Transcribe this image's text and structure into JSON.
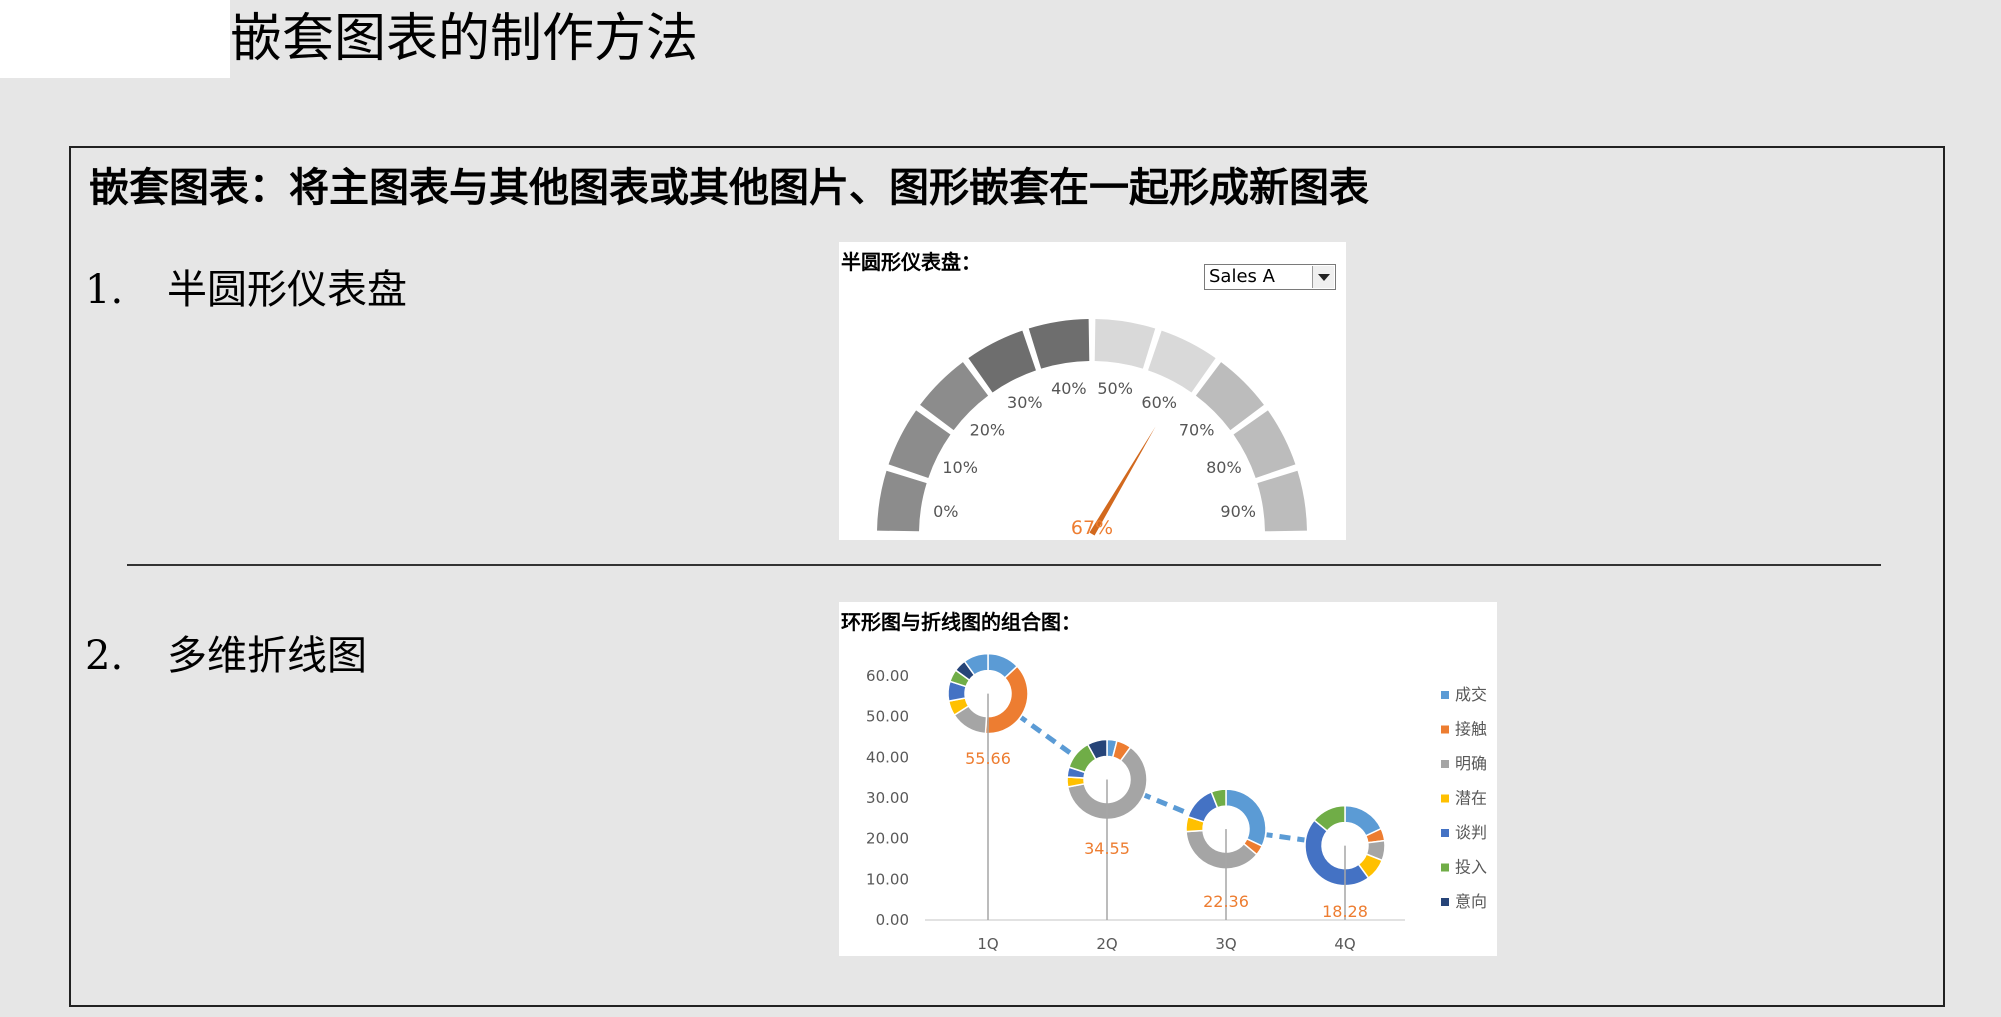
{
  "page": {
    "title": "嵌套图表的制作方法"
  },
  "frame": {
    "heading": "嵌套图表：将主图表与其他图表或其他图片、图形嵌套在一起形成新图表",
    "items": [
      {
        "number": "1.",
        "label": "半圆形仪表盘"
      },
      {
        "number": "2.",
        "label": "多维折线图"
      }
    ]
  },
  "gauge": {
    "heading": "半圆形仪表盘：",
    "selector_value": "Sales A",
    "value_label": "67%"
  },
  "combo": {
    "heading": "环形图与折线图的组合图："
  },
  "colors": {
    "page_bg": "#e6e6e6",
    "gauge_dark": "#6e6e6e",
    "gauge_mid": "#8c8c8c",
    "gauge_light": "#bcbcbc",
    "gauge_lighter": "#d9d9d9",
    "needle": "#d2691e",
    "value_text": "#ed7d31",
    "line": "#5b9bd5"
  },
  "chart_data": [
    {
      "type": "gauge",
      "title": "半圆形仪表盘：",
      "selector": "Sales A",
      "ticks": [
        "0%",
        "10%",
        "20%",
        "30%",
        "40%",
        "50%",
        "60%",
        "70%",
        "80%",
        "90%"
      ],
      "value": 0.67,
      "value_label": "67%"
    },
    {
      "type": "line",
      "title": "环形图与折线图的组合图：",
      "categories": [
        "1Q",
        "2Q",
        "3Q",
        "4Q"
      ],
      "values": [
        55.66,
        34.55,
        22.36,
        18.28
      ],
      "value_labels": [
        "55.66",
        "34.55",
        "22.36",
        "18.28"
      ],
      "y_ticks": [
        "0.00",
        "10.00",
        "20.00",
        "30.00",
        "40.00",
        "50.00",
        "60.00"
      ],
      "ylim": [
        0,
        60
      ],
      "legend_position": "right",
      "legend": [
        {
          "name": "成交",
          "color": "#5b9bd5"
        },
        {
          "name": "接触",
          "color": "#ed7d31"
        },
        {
          "name": "明确",
          "color": "#a5a5a5"
        },
        {
          "name": "潜在",
          "color": "#ffc000"
        },
        {
          "name": "谈判",
          "color": "#4472c4"
        },
        {
          "name": "投入",
          "color": "#70ad47"
        },
        {
          "name": "意向",
          "color": "#264478"
        }
      ],
      "donuts": [
        [
          0.13,
          0.38,
          0.15,
          0.06,
          0.08,
          0.05,
          0.05,
          0.1
        ],
        [
          0.04,
          0.06,
          0.62,
          0.04,
          0.04,
          0.12,
          0.08
        ],
        [
          0.32,
          0.04,
          0.38,
          0.06,
          0.14,
          0.06
        ],
        [
          0.18,
          0.05,
          0.08,
          0.09,
          0.46,
          0.14
        ]
      ]
    }
  ]
}
